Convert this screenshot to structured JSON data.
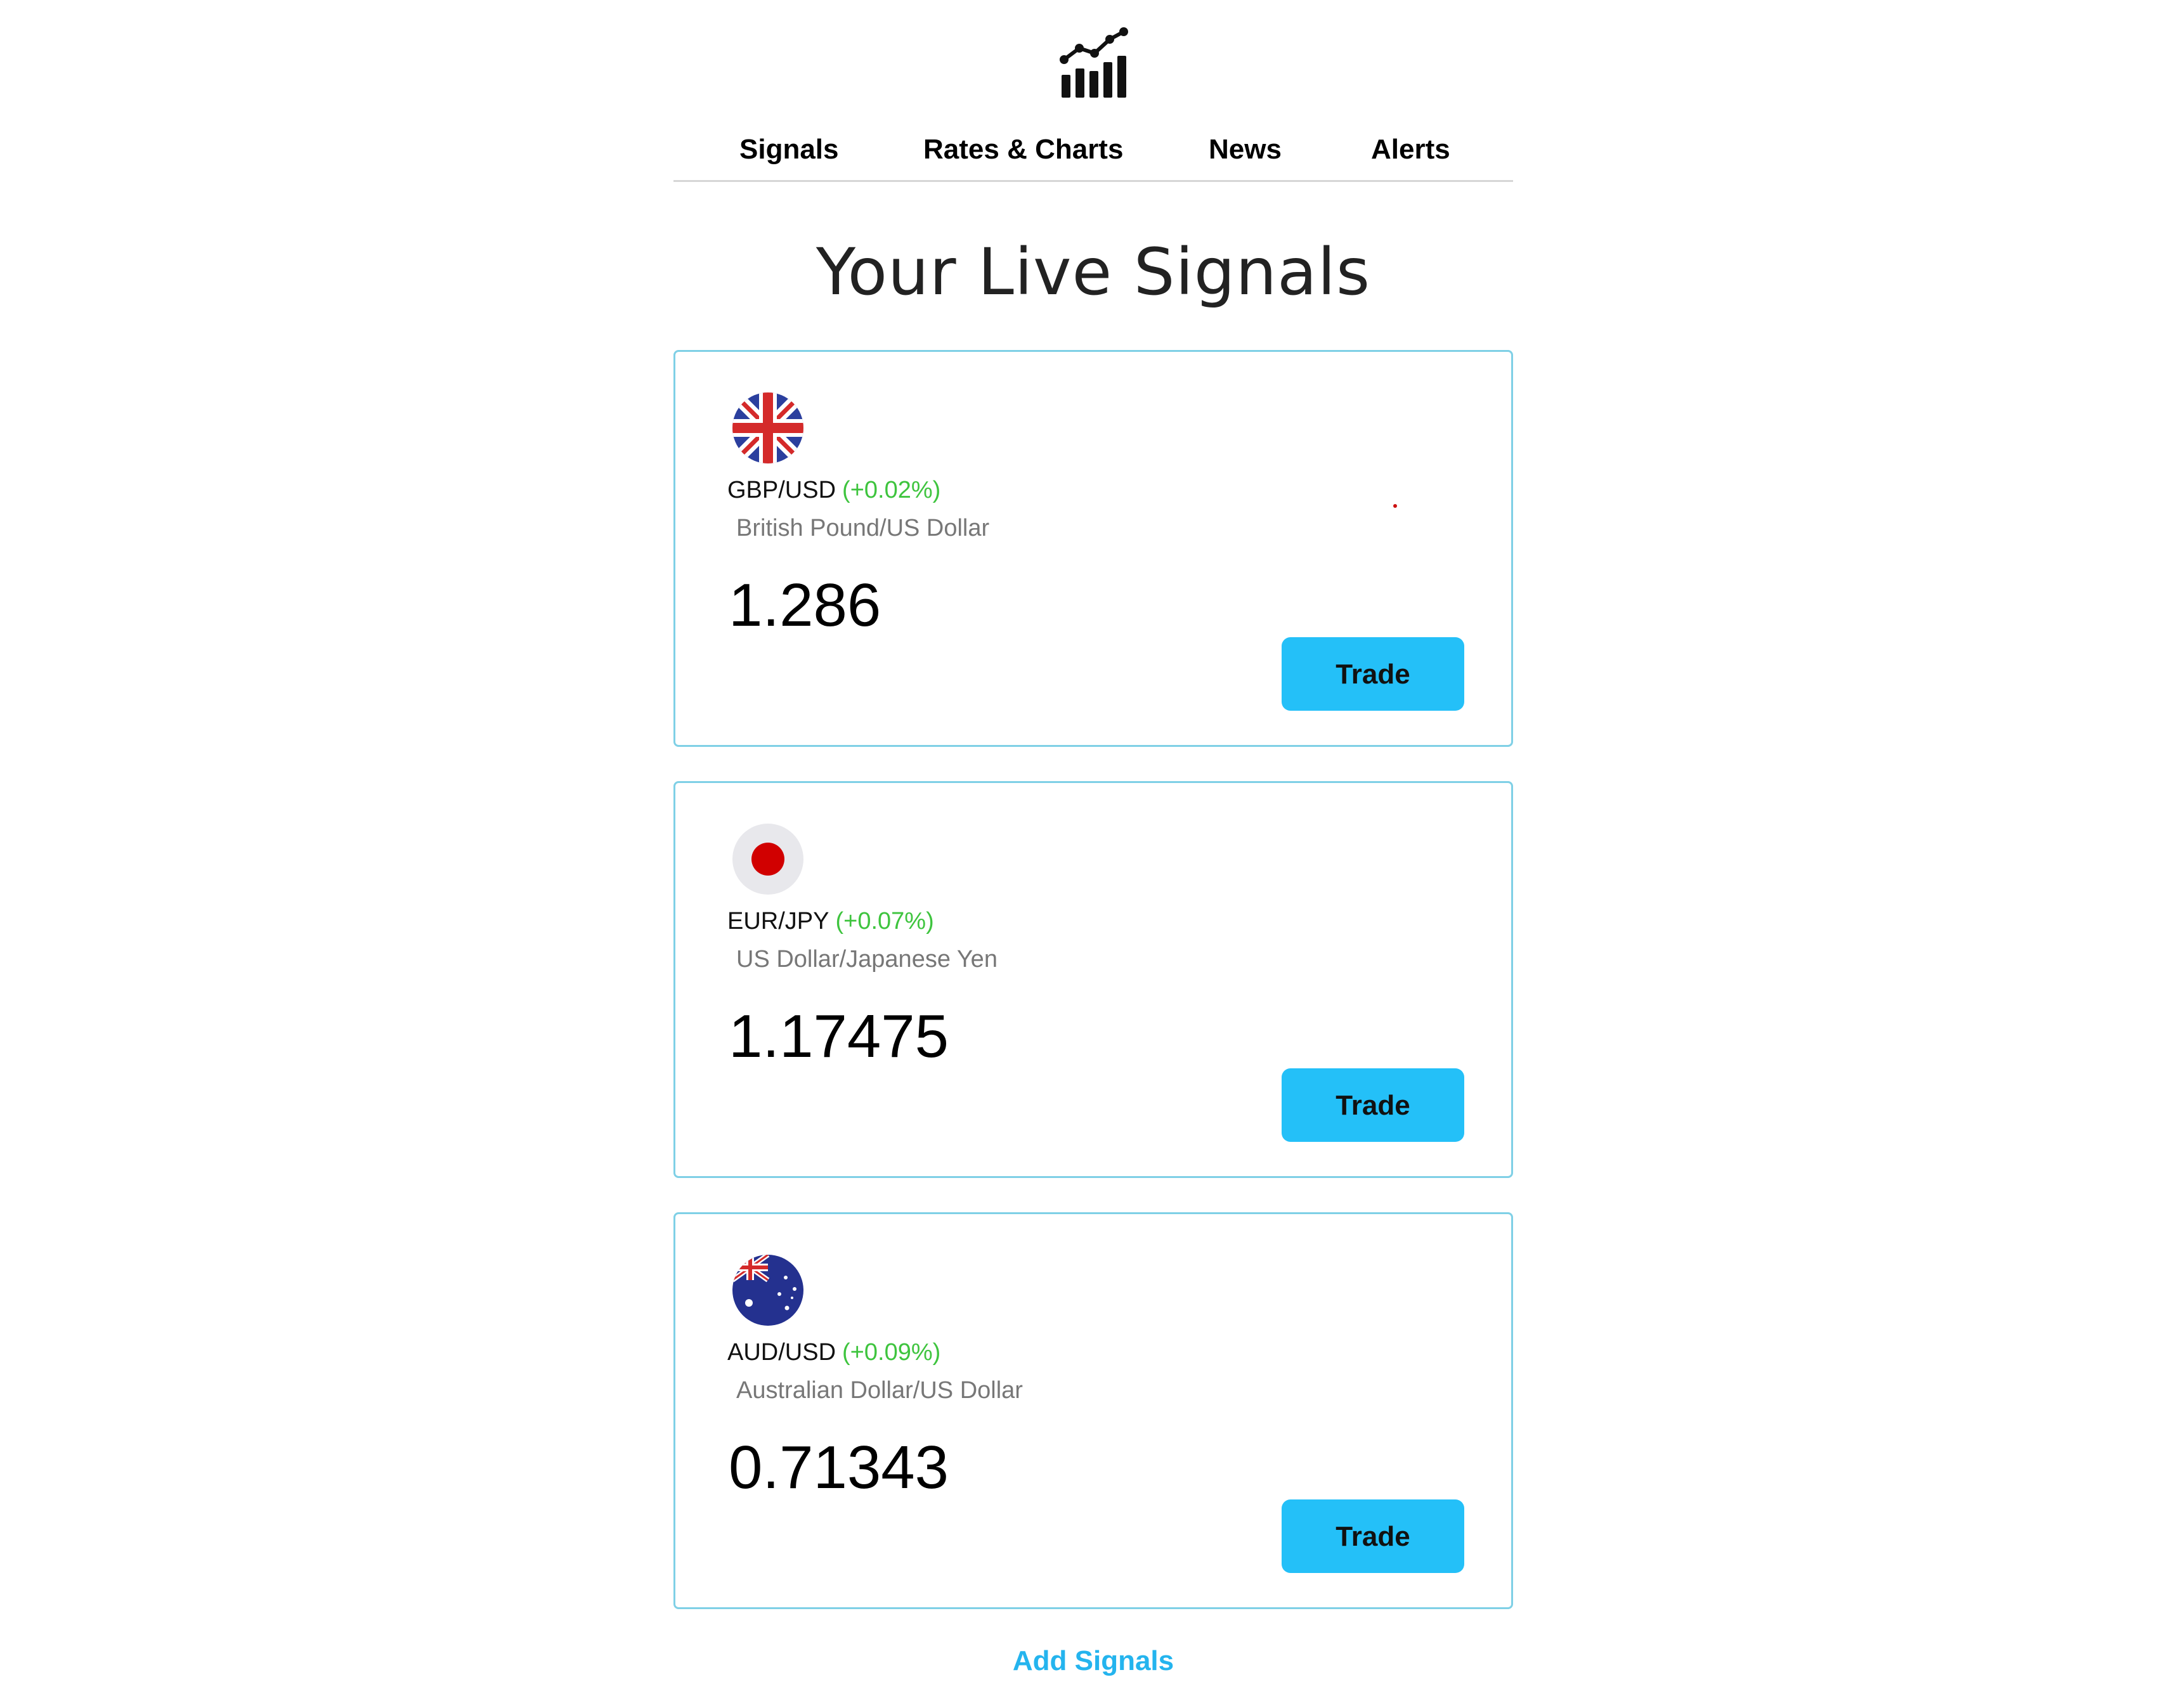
{
  "header": {
    "logo_icon": "bar-chart-trend-icon"
  },
  "nav": {
    "items": [
      {
        "label": "Signals"
      },
      {
        "label": "Rates & Charts"
      },
      {
        "label": "News"
      },
      {
        "label": "Alerts"
      }
    ]
  },
  "main": {
    "title": "Your Live Signals",
    "signals": [
      {
        "flag_icon": "uk-flag-icon",
        "pair": "GBP/USD",
        "change": "(+0.02%)",
        "description": "British Pound/US Dollar",
        "rate": "1.286",
        "action_label": "Trade"
      },
      {
        "flag_icon": "japan-flag-icon",
        "pair": "EUR/JPY",
        "change": "(+0.07%)",
        "description": "US Dollar/Japanese Yen",
        "rate": "1.17475",
        "action_label": "Trade"
      },
      {
        "flag_icon": "australia-flag-icon",
        "pair": "AUD/USD",
        "change": "(+0.09%)",
        "description": "Australian Dollar/US Dollar",
        "rate": "0.71343",
        "action_label": "Trade"
      }
    ],
    "add_label": "Add Signals"
  },
  "colors": {
    "accent": "#24c0f8",
    "positive_change": "#3ec43e",
    "card_border": "#7fd0e6"
  }
}
